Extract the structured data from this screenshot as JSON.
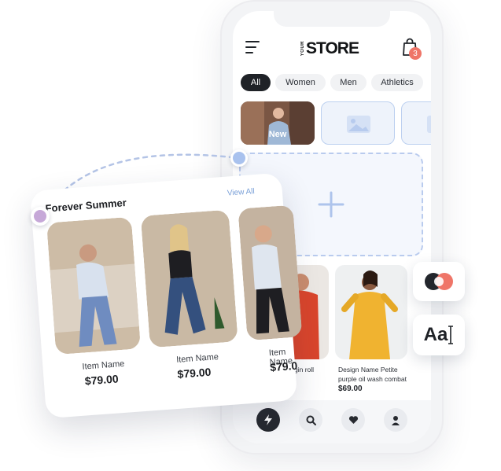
{
  "header": {
    "logo_small": "YOUR",
    "logo_main": "STORE",
    "cart_count": "3",
    "icons": [
      "menu-icon",
      "shopping-bag-icon"
    ]
  },
  "categories": [
    "All",
    "Women",
    "Men",
    "Athletics"
  ],
  "stories": {
    "new_label": "New"
  },
  "products": [
    {
      "name": "gin roll",
      "price": ""
    },
    {
      "name": "Design Name Petite purple oil wash combat",
      "price": "$69.00"
    }
  ],
  "tabbar": {
    "icons": [
      "lightning-icon",
      "search-icon",
      "heart-icon",
      "user-icon"
    ]
  },
  "collection_card": {
    "title": "Forever Summer",
    "view_all": "View All",
    "items": [
      {
        "name": "Item Name",
        "price": "$79.00"
      },
      {
        "name": "Item Name",
        "price": "$79.00"
      },
      {
        "name": "Item Name",
        "price": "$79.0"
      }
    ]
  },
  "tools": {
    "font_sample": "Aa"
  },
  "colors": {
    "accent_blue": "#a9c2ee",
    "accent_purple": "#c6a8d8",
    "accent_coral": "#ef7568",
    "dark": "#1f2227"
  }
}
